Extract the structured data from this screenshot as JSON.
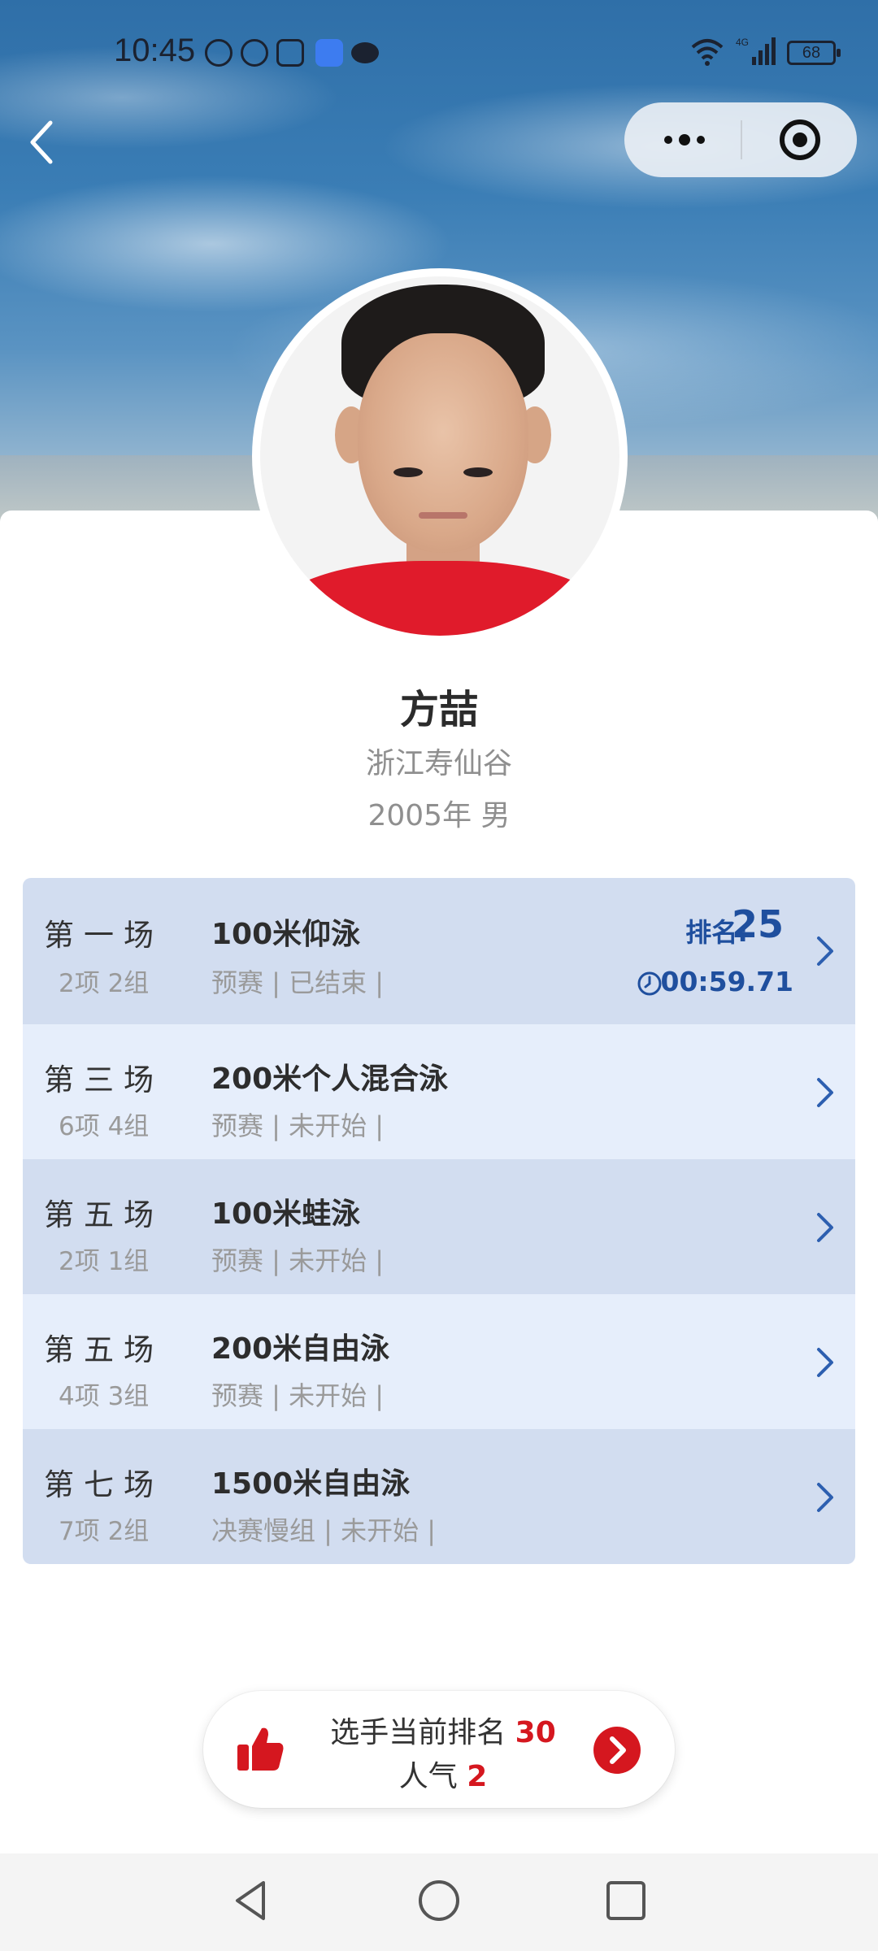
{
  "status_bar": {
    "time": "10:45",
    "battery": "68",
    "network": "4G"
  },
  "nav": {
    "back_icon": "chevron-left-icon",
    "more_icon": "more-dots-icon",
    "close_icon": "target-circle-icon"
  },
  "athlete": {
    "name": "方喆",
    "club": "浙江寿仙谷",
    "birth_gender": "2005年 男"
  },
  "events": [
    {
      "session": "第一场",
      "group": "2项 2组",
      "title": "100米仰泳",
      "status": "预赛 | 已结束 |",
      "rank_label": "排名:",
      "rank": "25",
      "time": "00:59.71"
    },
    {
      "session": "第三场",
      "group": "6项 4组",
      "title": "200米个人混合泳",
      "status": "预赛 | 未开始 |"
    },
    {
      "session": "第五场",
      "group": "2项 1组",
      "title": "100米蛙泳",
      "status": "预赛 | 未开始 |"
    },
    {
      "session": "第五场",
      "group": "4项 3组",
      "title": "200米自由泳",
      "status": "预赛 | 未开始 |"
    },
    {
      "session": "第七场",
      "group": "7项 2组",
      "title": "1500米自由泳",
      "status": "决赛慢组 | 未开始 |"
    }
  ],
  "popularity": {
    "rank_label": "选手当前排名",
    "rank_value": "30",
    "popularity_label": "人气",
    "popularity_value": "2"
  },
  "colors": {
    "accent_blue": "#1f4f9e",
    "accent_red": "#d5171f",
    "row_dark": "#d2ddf0",
    "row_light": "#e6eefb"
  }
}
